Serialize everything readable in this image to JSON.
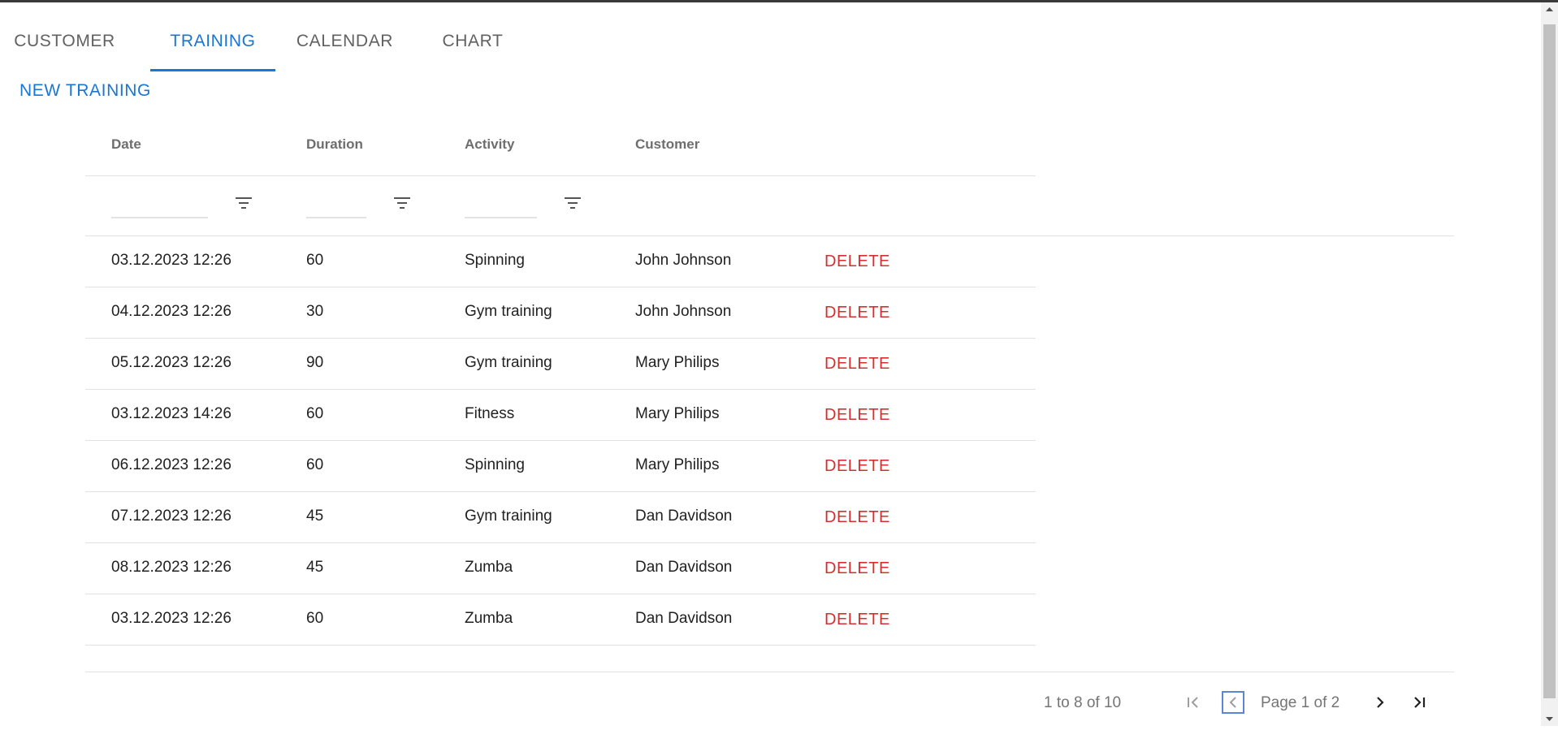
{
  "tabs": [
    {
      "label": "CUSTOMER"
    },
    {
      "label": "TRAINING"
    },
    {
      "label": "CALENDAR"
    },
    {
      "label": "CHART"
    }
  ],
  "active_tab": "TRAINING",
  "actions": {
    "new_training": "NEW TRAINING"
  },
  "grid": {
    "columns": [
      "Date",
      "Duration",
      "Activity",
      "Customer"
    ],
    "delete_label": "DELETE",
    "rows": [
      {
        "date": "03.12.2023 12:26",
        "duration": "60",
        "activity": "Spinning",
        "customer": "John Johnson"
      },
      {
        "date": "04.12.2023 12:26",
        "duration": "30",
        "activity": "Gym training",
        "customer": "John Johnson"
      },
      {
        "date": "05.12.2023 12:26",
        "duration": "90",
        "activity": "Gym training",
        "customer": "Mary Philips"
      },
      {
        "date": "03.12.2023 14:26",
        "duration": "60",
        "activity": "Fitness",
        "customer": "Mary Philips"
      },
      {
        "date": "06.12.2023 12:26",
        "duration": "60",
        "activity": "Spinning",
        "customer": "Mary Philips"
      },
      {
        "date": "07.12.2023 12:26",
        "duration": "45",
        "activity": "Gym training",
        "customer": "Dan Davidson"
      },
      {
        "date": "08.12.2023 12:26",
        "duration": "45",
        "activity": "Zumba",
        "customer": "Dan Davidson"
      },
      {
        "date": "03.12.2023 12:26",
        "duration": "60",
        "activity": "Zumba",
        "customer": "Dan Davidson"
      }
    ]
  },
  "pagination": {
    "summary": "1 to 8 of 10",
    "page_label": "Page 1 of 2",
    "icons": [
      "first-page-icon",
      "previous-page-icon",
      "next-page-icon",
      "last-page-icon"
    ]
  },
  "colors": {
    "accent": "#1976d2",
    "delete": "#d32f2f",
    "header_text": "#6e6e6e",
    "muted_text": "#757575",
    "divider": "#e2e2e2"
  }
}
